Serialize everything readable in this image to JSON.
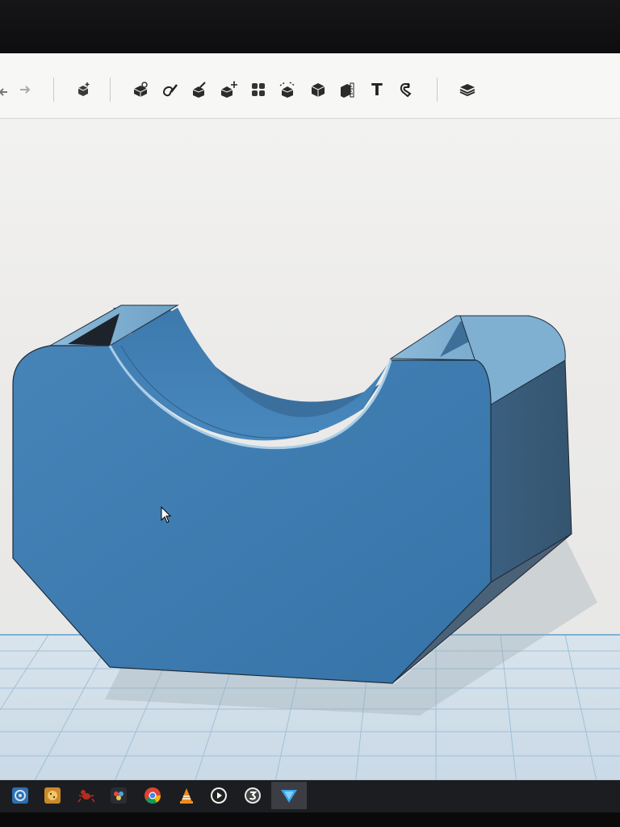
{
  "toolbar": {
    "tools": [
      {
        "icon": "undo-icon"
      },
      {
        "icon": "redo-icon"
      },
      {
        "icon": "add-shape-icon"
      },
      {
        "icon": "workplane-icon"
      },
      {
        "icon": "paint-icon"
      },
      {
        "icon": "measure-icon"
      },
      {
        "icon": "move-icon"
      },
      {
        "icon": "group-icon"
      },
      {
        "icon": "align-icon"
      },
      {
        "icon": "solid-icon"
      },
      {
        "icon": "ruler-icon"
      },
      {
        "icon": "text-icon",
        "label": "T"
      },
      {
        "icon": "magnet-icon"
      },
      {
        "icon": "layers-icon"
      }
    ]
  },
  "viewport": {
    "model_color": "#3f7fb4",
    "grid_color": "#8fb8d6",
    "background_color": "#ecebe9"
  },
  "taskbar": {
    "apps": [
      {
        "icon": "app-settings-icon"
      },
      {
        "icon": "app-cookie-icon"
      },
      {
        "icon": "app-ant-icon"
      },
      {
        "icon": "app-davinci-icon"
      },
      {
        "icon": "chrome-icon"
      },
      {
        "icon": "vlc-icon"
      },
      {
        "icon": "media-player-icon"
      },
      {
        "icon": "app-3-icon"
      },
      {
        "icon": "slicer-icon"
      }
    ],
    "active_color": "#3b3d42"
  }
}
